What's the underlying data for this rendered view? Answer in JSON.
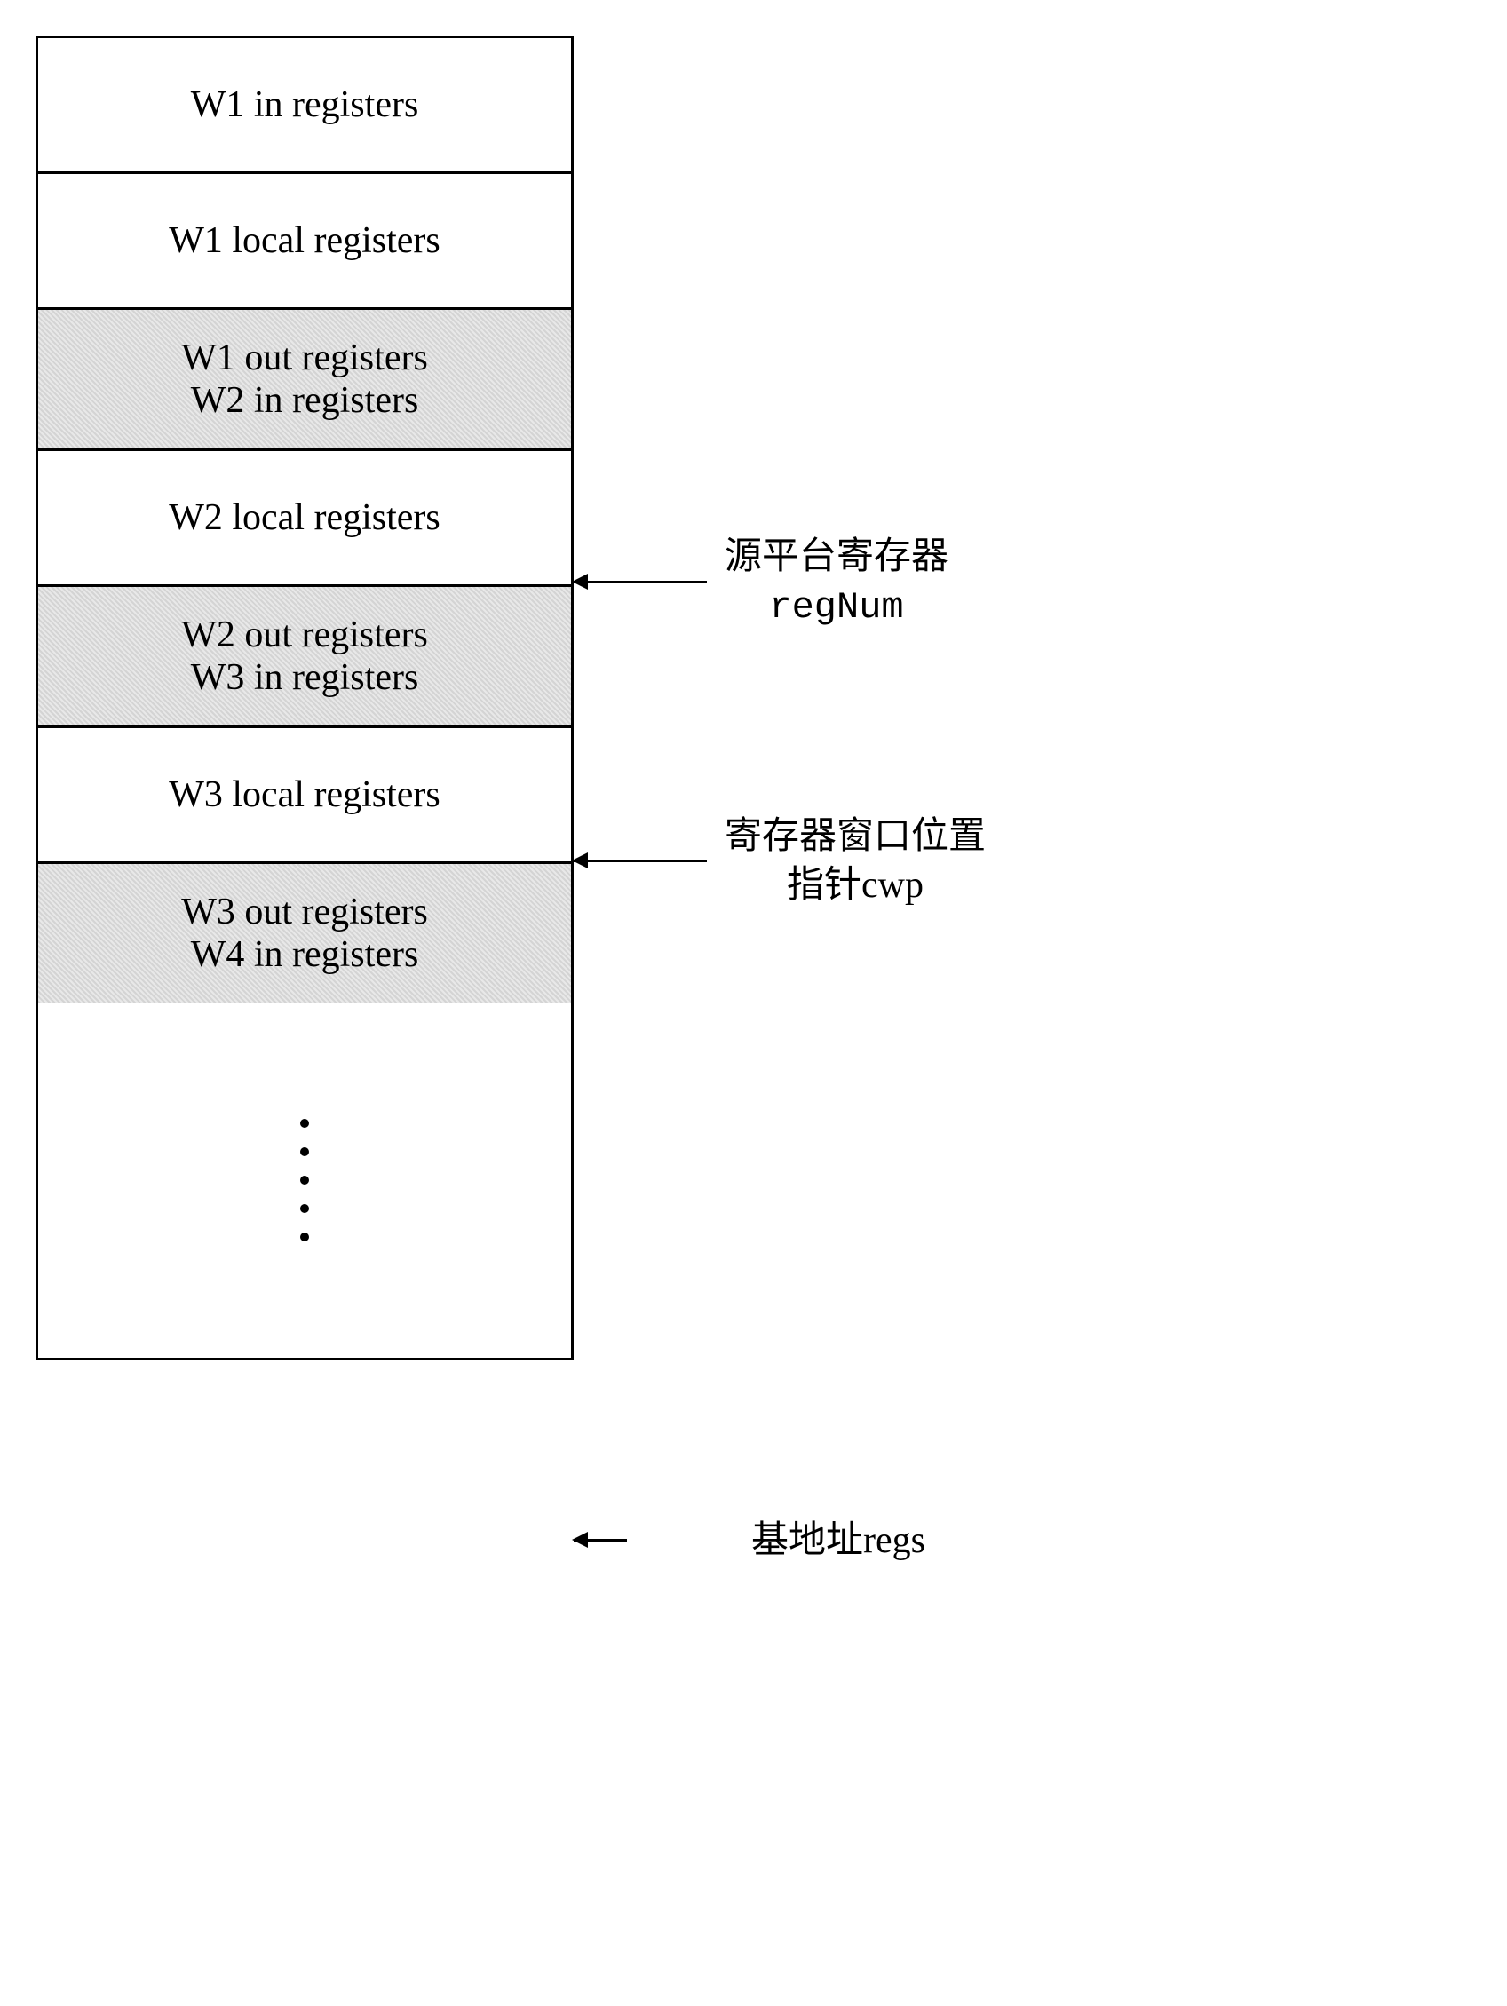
{
  "cells": [
    {
      "lines": [
        "W1 in registers"
      ],
      "shaded": false
    },
    {
      "lines": [
        "W1 local registers"
      ],
      "shaded": false
    },
    {
      "lines": [
        "W1 out registers",
        "W2 in registers"
      ],
      "shaded": true
    },
    {
      "lines": [
        "W2 local registers"
      ],
      "shaded": false
    },
    {
      "lines": [
        "W2 out registers",
        "W3 in registers"
      ],
      "shaded": true
    },
    {
      "lines": [
        "W3 local registers"
      ],
      "shaded": false
    },
    {
      "lines": [
        "W3 out registers",
        "W4 in registers"
      ],
      "shaded": true
    }
  ],
  "annotations": {
    "regnum": {
      "line1": "源平台寄存器",
      "line2": "regNum"
    },
    "cwp": {
      "line1": "寄存器窗口位置",
      "line2": "指针cwp"
    },
    "base": {
      "text": "基地址regs"
    }
  }
}
